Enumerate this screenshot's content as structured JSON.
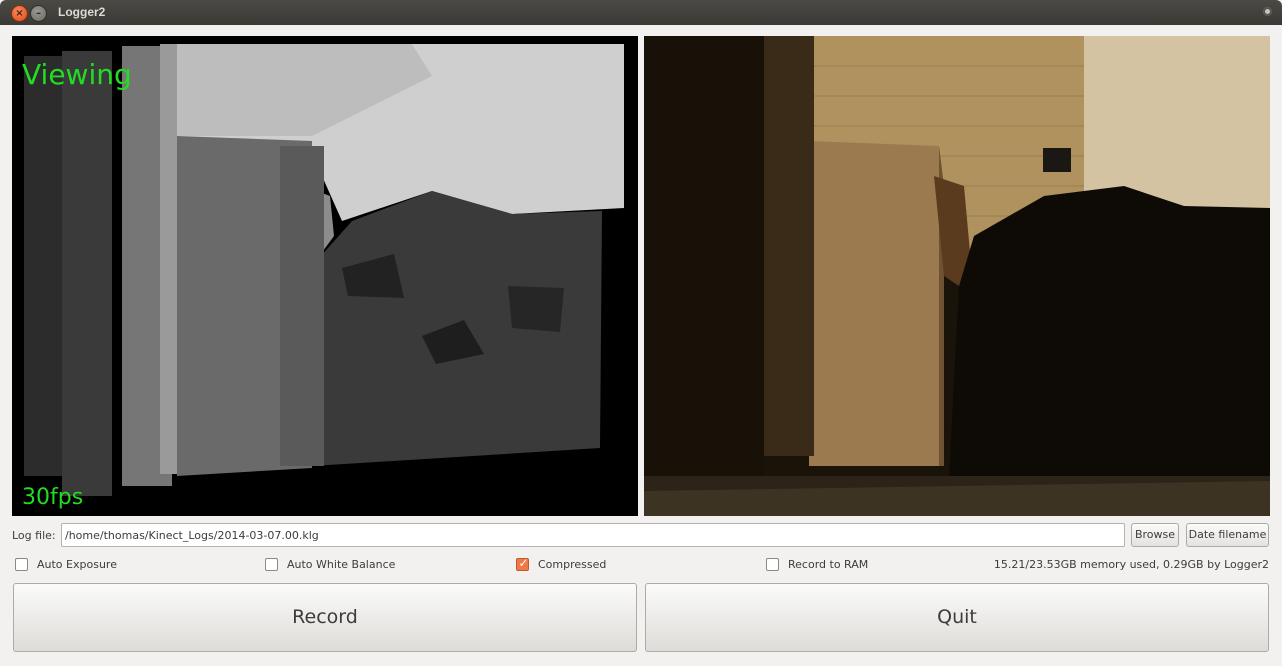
{
  "window": {
    "title": "Logger2"
  },
  "depth_view": {
    "status": "Viewing",
    "fps": "30fps"
  },
  "log_file": {
    "label": "Log file:",
    "value": "/home/thomas/Kinect_Logs/2014-03-07.00.klg"
  },
  "buttons": {
    "browse": "Browse",
    "date_filename": "Date filename",
    "record": "Record",
    "quit": "Quit"
  },
  "options": [
    {
      "label": "Auto Exposure",
      "checked": false
    },
    {
      "label": "Auto White Balance",
      "checked": false
    },
    {
      "label": "Compressed",
      "checked": true
    },
    {
      "label": "Record to RAM",
      "checked": false
    }
  ],
  "memory_status": "15.21/23.53GB memory used, 0.29GB by Logger2",
  "colors": {
    "overlay_text": "#22dd22",
    "accent_checkbox": "#f07746",
    "titlebar": "#3c3b37"
  },
  "icons": [
    "close-icon",
    "minimize-icon",
    "window-menu-icon",
    "checkmark-icon"
  ]
}
